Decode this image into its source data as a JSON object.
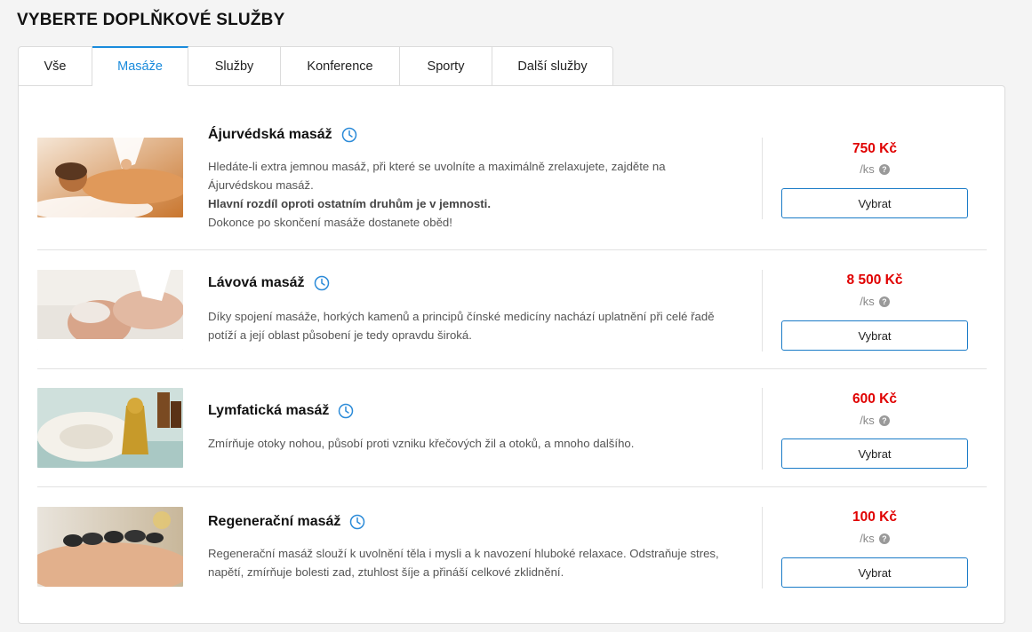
{
  "page": {
    "title": "VYBERTE DOPLŇKOVÉ SLUŽBY"
  },
  "tabs": [
    {
      "label": "Vše"
    },
    {
      "label": "Masáže"
    },
    {
      "label": "Služby"
    },
    {
      "label": "Konference"
    },
    {
      "label": "Sporty"
    },
    {
      "label": "Další služby"
    }
  ],
  "active_tab": "Masáže",
  "colors": {
    "accent": "#1a8bdc",
    "price": "#e00000",
    "button_border": "#1a7bc7"
  },
  "items": [
    {
      "title": "Ájurvédská masáž",
      "desc_1": "Hledáte-li extra jemnou masáž, při které se uvolníte a maximálně zrelaxujete, zajděte na Ájurvédskou masáž.",
      "desc_bold": "Hlavní rozdíl oproti ostatním druhům je v jemnosti.",
      "desc_2": "Dokonce po skončení masáže dostanete oběd!",
      "price": "750 Kč",
      "unit": "/ks",
      "button": "Vybrat",
      "icon": "clock-icon"
    },
    {
      "title": "Lávová masáž",
      "desc_1": "Díky spojení masáže, horkých kamenů a principů čínské medicíny nachází uplatnění při celé řadě potíží a její oblast působení je tedy opravdu široká.",
      "price": "8 500 Kč",
      "unit": "/ks",
      "button": "Vybrat",
      "icon": "clock-icon"
    },
    {
      "title": "Lymfatická masáž",
      "desc_1": "Zmírňuje otoky nohou, působí proti vzniku křečových žil a otoků, a mnoho dalšího.",
      "price": "600 Kč",
      "unit": "/ks",
      "button": "Vybrat",
      "icon": "clock-icon"
    },
    {
      "title": "Regenerační masáž",
      "desc_1": "Regenerační masáž slouží k uvolnění těla i mysli a k navození hluboké relaxace. Odstraňuje stres, napětí, zmírňuje bolesti zad, ztuhlost šíje a přináší celkové zklidnění.",
      "price": "100 Kč",
      "unit": "/ks",
      "button": "Vybrat",
      "icon": "clock-icon"
    }
  ]
}
